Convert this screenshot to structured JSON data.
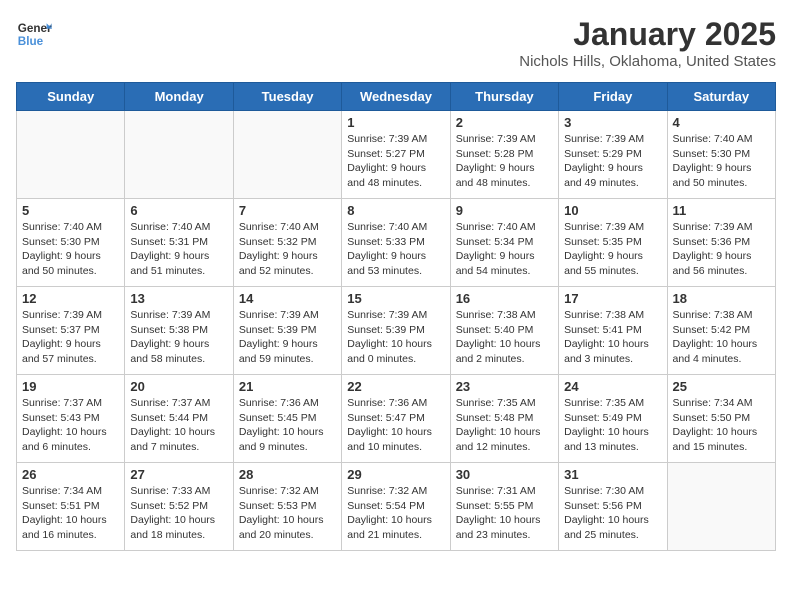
{
  "header": {
    "logo_line1": "General",
    "logo_line2": "Blue",
    "month_year": "January 2025",
    "location": "Nichols Hills, Oklahoma, United States"
  },
  "weekdays": [
    "Sunday",
    "Monday",
    "Tuesday",
    "Wednesday",
    "Thursday",
    "Friday",
    "Saturday"
  ],
  "weeks": [
    [
      {
        "day": "",
        "info": ""
      },
      {
        "day": "",
        "info": ""
      },
      {
        "day": "",
        "info": ""
      },
      {
        "day": "1",
        "info": "Sunrise: 7:39 AM\nSunset: 5:27 PM\nDaylight: 9 hours\nand 48 minutes."
      },
      {
        "day": "2",
        "info": "Sunrise: 7:39 AM\nSunset: 5:28 PM\nDaylight: 9 hours\nand 48 minutes."
      },
      {
        "day": "3",
        "info": "Sunrise: 7:39 AM\nSunset: 5:29 PM\nDaylight: 9 hours\nand 49 minutes."
      },
      {
        "day": "4",
        "info": "Sunrise: 7:40 AM\nSunset: 5:30 PM\nDaylight: 9 hours\nand 50 minutes."
      }
    ],
    [
      {
        "day": "5",
        "info": "Sunrise: 7:40 AM\nSunset: 5:30 PM\nDaylight: 9 hours\nand 50 minutes."
      },
      {
        "day": "6",
        "info": "Sunrise: 7:40 AM\nSunset: 5:31 PM\nDaylight: 9 hours\nand 51 minutes."
      },
      {
        "day": "7",
        "info": "Sunrise: 7:40 AM\nSunset: 5:32 PM\nDaylight: 9 hours\nand 52 minutes."
      },
      {
        "day": "8",
        "info": "Sunrise: 7:40 AM\nSunset: 5:33 PM\nDaylight: 9 hours\nand 53 minutes."
      },
      {
        "day": "9",
        "info": "Sunrise: 7:40 AM\nSunset: 5:34 PM\nDaylight: 9 hours\nand 54 minutes."
      },
      {
        "day": "10",
        "info": "Sunrise: 7:39 AM\nSunset: 5:35 PM\nDaylight: 9 hours\nand 55 minutes."
      },
      {
        "day": "11",
        "info": "Sunrise: 7:39 AM\nSunset: 5:36 PM\nDaylight: 9 hours\nand 56 minutes."
      }
    ],
    [
      {
        "day": "12",
        "info": "Sunrise: 7:39 AM\nSunset: 5:37 PM\nDaylight: 9 hours\nand 57 minutes."
      },
      {
        "day": "13",
        "info": "Sunrise: 7:39 AM\nSunset: 5:38 PM\nDaylight: 9 hours\nand 58 minutes."
      },
      {
        "day": "14",
        "info": "Sunrise: 7:39 AM\nSunset: 5:39 PM\nDaylight: 9 hours\nand 59 minutes."
      },
      {
        "day": "15",
        "info": "Sunrise: 7:39 AM\nSunset: 5:39 PM\nDaylight: 10 hours\nand 0 minutes."
      },
      {
        "day": "16",
        "info": "Sunrise: 7:38 AM\nSunset: 5:40 PM\nDaylight: 10 hours\nand 2 minutes."
      },
      {
        "day": "17",
        "info": "Sunrise: 7:38 AM\nSunset: 5:41 PM\nDaylight: 10 hours\nand 3 minutes."
      },
      {
        "day": "18",
        "info": "Sunrise: 7:38 AM\nSunset: 5:42 PM\nDaylight: 10 hours\nand 4 minutes."
      }
    ],
    [
      {
        "day": "19",
        "info": "Sunrise: 7:37 AM\nSunset: 5:43 PM\nDaylight: 10 hours\nand 6 minutes."
      },
      {
        "day": "20",
        "info": "Sunrise: 7:37 AM\nSunset: 5:44 PM\nDaylight: 10 hours\nand 7 minutes."
      },
      {
        "day": "21",
        "info": "Sunrise: 7:36 AM\nSunset: 5:45 PM\nDaylight: 10 hours\nand 9 minutes."
      },
      {
        "day": "22",
        "info": "Sunrise: 7:36 AM\nSunset: 5:47 PM\nDaylight: 10 hours\nand 10 minutes."
      },
      {
        "day": "23",
        "info": "Sunrise: 7:35 AM\nSunset: 5:48 PM\nDaylight: 10 hours\nand 12 minutes."
      },
      {
        "day": "24",
        "info": "Sunrise: 7:35 AM\nSunset: 5:49 PM\nDaylight: 10 hours\nand 13 minutes."
      },
      {
        "day": "25",
        "info": "Sunrise: 7:34 AM\nSunset: 5:50 PM\nDaylight: 10 hours\nand 15 minutes."
      }
    ],
    [
      {
        "day": "26",
        "info": "Sunrise: 7:34 AM\nSunset: 5:51 PM\nDaylight: 10 hours\nand 16 minutes."
      },
      {
        "day": "27",
        "info": "Sunrise: 7:33 AM\nSunset: 5:52 PM\nDaylight: 10 hours\nand 18 minutes."
      },
      {
        "day": "28",
        "info": "Sunrise: 7:32 AM\nSunset: 5:53 PM\nDaylight: 10 hours\nand 20 minutes."
      },
      {
        "day": "29",
        "info": "Sunrise: 7:32 AM\nSunset: 5:54 PM\nDaylight: 10 hours\nand 21 minutes."
      },
      {
        "day": "30",
        "info": "Sunrise: 7:31 AM\nSunset: 5:55 PM\nDaylight: 10 hours\nand 23 minutes."
      },
      {
        "day": "31",
        "info": "Sunrise: 7:30 AM\nSunset: 5:56 PM\nDaylight: 10 hours\nand 25 minutes."
      },
      {
        "day": "",
        "info": ""
      }
    ]
  ]
}
